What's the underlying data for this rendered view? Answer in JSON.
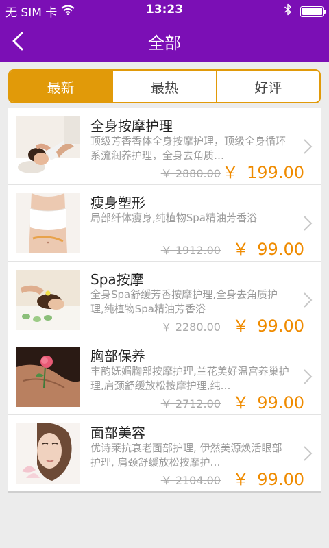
{
  "status_bar": {
    "carrier": "无 SIM 卡",
    "time": "13:23",
    "icons": [
      "wifi-icon",
      "bluetooth-icon",
      "battery-icon"
    ]
  },
  "nav": {
    "title": "全部",
    "back_icon": "chevron-left-icon"
  },
  "tabs": [
    {
      "label": "最新",
      "active": true
    },
    {
      "label": "最热",
      "active": false
    },
    {
      "label": "好评",
      "active": false
    }
  ],
  "items": [
    {
      "title": "全身按摩护理",
      "description": "顶级芳香香体全身按摩护理，顶级全身循环系流润养护理，全身去角质…",
      "old_price": "￥ 2880.00",
      "currency": "￥",
      "price": "199.00",
      "image": "full-body-massage-photo"
    },
    {
      "title": "瘦身塑形",
      "description": "局部纤体瘦身,纯植物Spa精油芳香浴",
      "old_price": "￥ 1912.00",
      "currency": "￥",
      "price": "99.00",
      "image": "slimming-waist-photo"
    },
    {
      "title": "Spa按摩",
      "description": "全身Spa舒缓芳香按摩护理,全身去角质护理,纯植物Spa精油芳香浴",
      "old_price": "￥ 2280.00",
      "currency": "￥",
      "price": "99.00",
      "image": "spa-massage-photo"
    },
    {
      "title": " 胸部保养",
      "description": "丰韵妩媚胸部按摩护理,兰花美好温宫养巢护理,肩颈舒缓放松按摩护理,纯…",
      "old_price": "￥ 2712.00",
      "currency": "￥",
      "price": "99.00",
      "image": "chest-care-rose-photo"
    },
    {
      "title": "面部美容",
      "description": "优诗莱抗衰老面部护理, 伊然美源焕活眼部护理, 肩颈舒缓放松按摩护…",
      "old_price": "￥ 2104.00",
      "currency": "￥",
      "price": "99.00",
      "image": "facial-beauty-photo"
    }
  ],
  "colors": {
    "nav_bg": "#7b0fb5",
    "tab_accent": "#e19a09",
    "price": "#ef8b00"
  }
}
